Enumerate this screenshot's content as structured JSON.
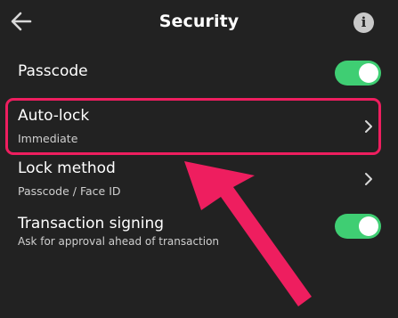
{
  "header": {
    "title": "Security"
  },
  "rows": [
    {
      "title": "Passcode"
    },
    {
      "title": "Auto-lock",
      "subtitle": "Immediate"
    },
    {
      "title": "Lock method",
      "subtitle": "Passcode / Face ID"
    },
    {
      "title": "Transaction signing",
      "subtitle": "Ask for approval ahead of transaction"
    }
  ],
  "toggles": {
    "passcode": true,
    "transaction_signing": true
  },
  "colors": {
    "background": "#222222",
    "toggle_on": "#3fce73",
    "highlight": "#ee1e5f"
  },
  "icons": {
    "back": "back-arrow-icon",
    "info": "info-icon",
    "chevron": "chevron-right-icon"
  }
}
